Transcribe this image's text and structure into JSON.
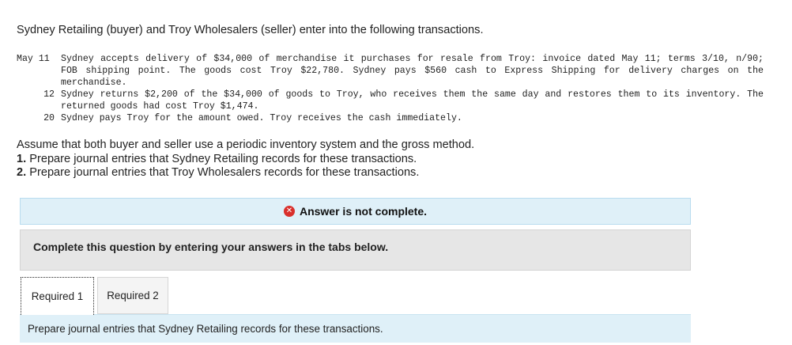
{
  "intro": "Sydney Retailing (buyer) and Troy Wholesalers (seller) enter into the following transactions.",
  "transactions": [
    {
      "date": "May 11",
      "text": "Sydney accepts delivery of $34,000 of merchandise it purchases for resale from Troy: invoice dated May 11; terms 3/10, n/90; FOB shipping point. The goods cost Troy $22,780. Sydney pays $560 cash to Express Shipping for delivery charges on the merchandise."
    },
    {
      "date": "12",
      "text": "Sydney returns $2,200 of the $34,000 of goods to Troy, who receives them the same day and restores them to its inventory. The returned goods had cost Troy $1,474."
    },
    {
      "date": "20",
      "text": "Sydney pays Troy for the amount owed. Troy receives the cash immediately."
    }
  ],
  "assumption": "Assume that both buyer and seller use a periodic inventory system and the gross method.",
  "requirements": [
    {
      "number": "1.",
      "text": "Prepare journal entries that Sydney Retailing records for these transactions."
    },
    {
      "number": "2.",
      "text": "Prepare journal entries that Troy Wholesalers records for these transactions."
    }
  ],
  "status_banner": {
    "icon": "x-circle-icon",
    "text": "Answer is not complete.",
    "color": "#d9302c"
  },
  "panel_text": "Complete this question by entering your answers in the tabs below.",
  "tabs": [
    {
      "label": "Required 1",
      "active": true
    },
    {
      "label": "Required 2",
      "active": false
    }
  ],
  "instruction": "Prepare journal entries that Sydney Retailing records for these transactions.",
  "colors": {
    "banner_bg": "#dff0f8",
    "panel_bg": "#e6e6e6"
  }
}
